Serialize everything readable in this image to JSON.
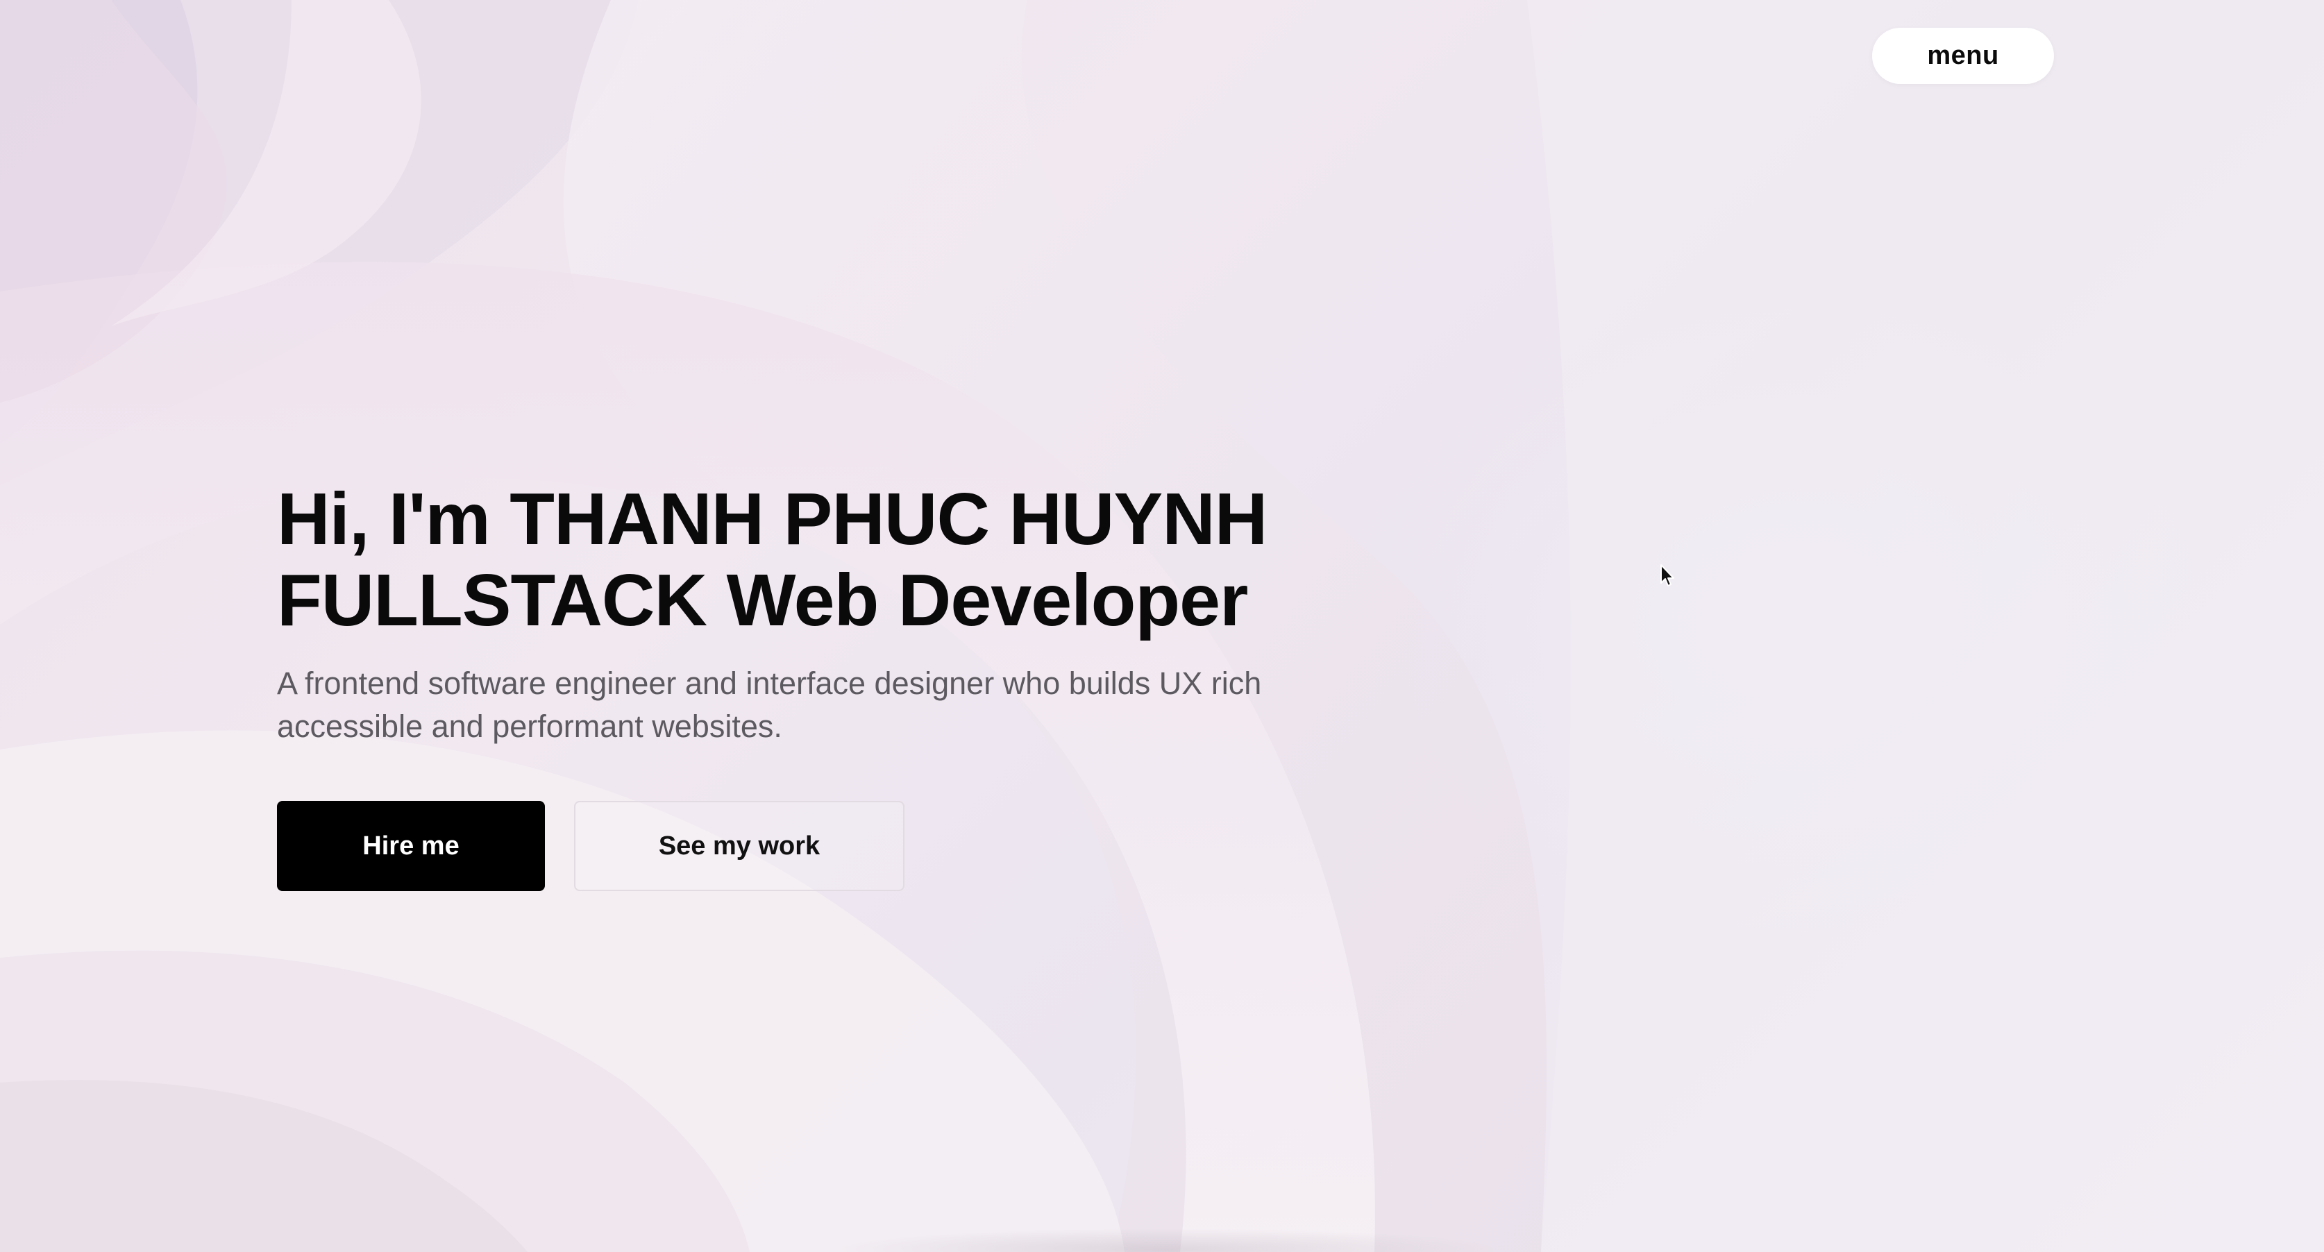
{
  "header": {
    "menu_label": "menu"
  },
  "hero": {
    "title_line1": "Hi, I'm THANH PHUC HUYNH",
    "title_line2": "FULLSTACK Web Developer",
    "subtitle": "A frontend software engineer and interface designer who builds UX rich accessible and performant websites."
  },
  "actions": {
    "hire_label": "Hire me",
    "work_label": "See my work"
  },
  "colors": {
    "primary_button": "#000000",
    "primary_text": "#ffffff",
    "heading": "#0a0a0a",
    "subtitle": "#5c5a60",
    "background": "#efe7ee"
  },
  "icons": {
    "cursor": "mouse-pointer-icon"
  }
}
